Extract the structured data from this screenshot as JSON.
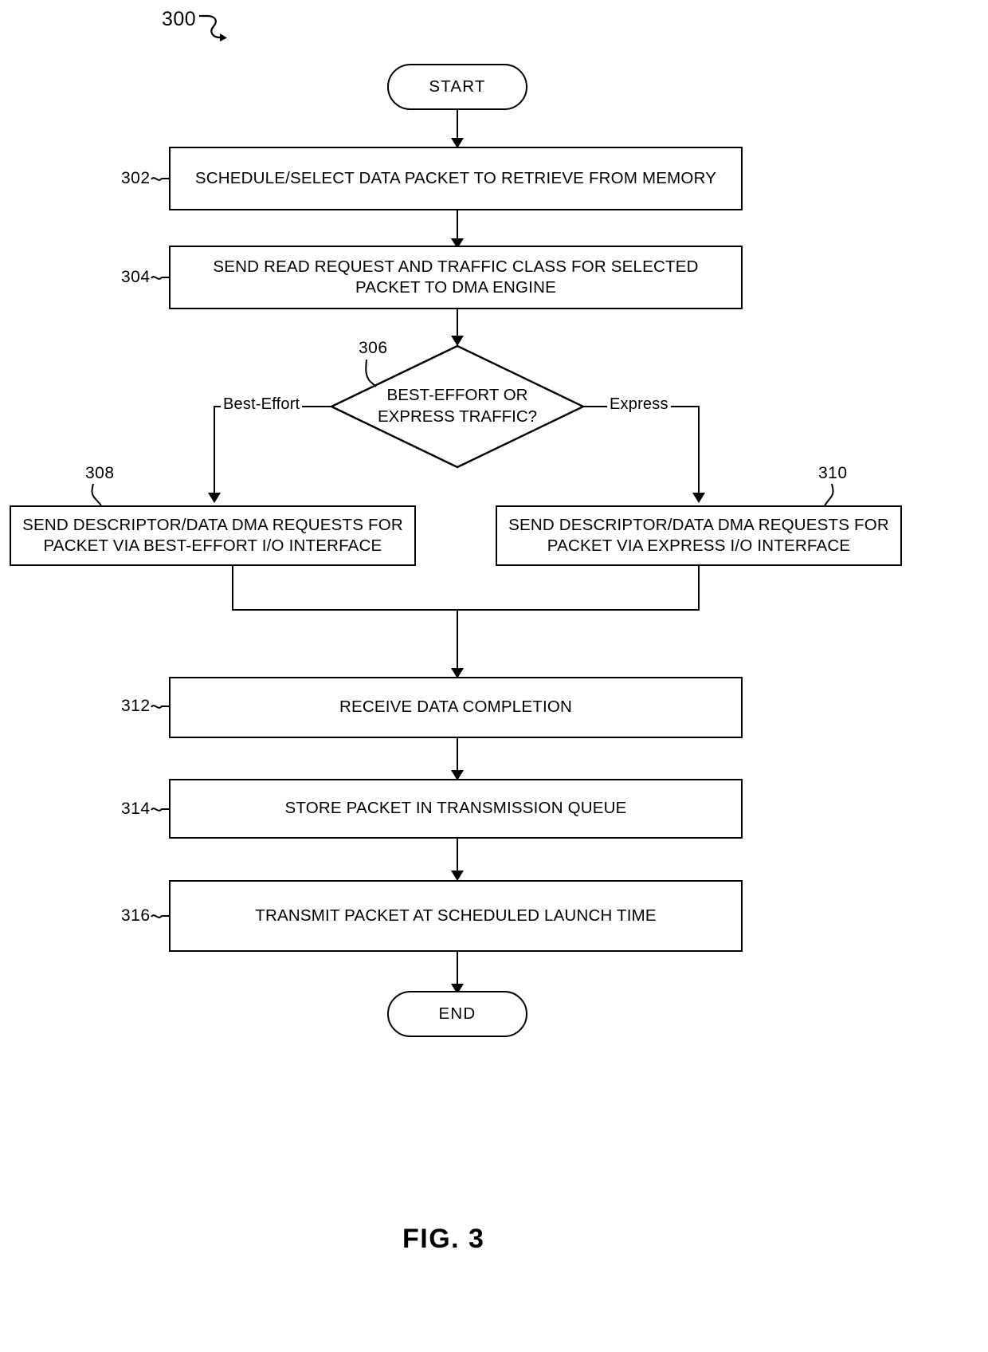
{
  "figure": {
    "caption": "FIG. 3",
    "diagram_number": "300"
  },
  "nodes": {
    "start": {
      "label": "START",
      "ref": ""
    },
    "n302": {
      "label": "SCHEDULE/SELECT DATA PACKET TO RETRIEVE FROM MEMORY",
      "ref": "302"
    },
    "n304": {
      "line1": "SEND READ REQUEST AND TRAFFIC CLASS FOR SELECTED",
      "line2": "PACKET TO DMA ENGINE",
      "ref": "304"
    },
    "n306": {
      "line1": "BEST-EFFORT OR",
      "line2": "EXPRESS TRAFFIC?",
      "ref": "306"
    },
    "n308": {
      "line1": "SEND DESCRIPTOR/DATA DMA REQUESTS FOR",
      "line2": "PACKET VIA BEST-EFFORT I/O INTERFACE",
      "ref": "308"
    },
    "n310": {
      "line1": "SEND DESCRIPTOR/DATA DMA REQUESTS FOR",
      "line2": "PACKET VIA EXPRESS I/O INTERFACE",
      "ref": "310"
    },
    "n312": {
      "label": "RECEIVE DATA COMPLETION",
      "ref": "312"
    },
    "n314": {
      "label": "STORE PACKET IN TRANSMISSION QUEUE",
      "ref": "314"
    },
    "n316": {
      "label": "TRANSMIT PACKET AT SCHEDULED LAUNCH TIME",
      "ref": "316"
    },
    "end": {
      "label": "END",
      "ref": ""
    }
  },
  "branches": {
    "left": "Best-Effort",
    "right": "Express"
  },
  "colors": {
    "stroke": "#000000",
    "background": "#ffffff"
  }
}
